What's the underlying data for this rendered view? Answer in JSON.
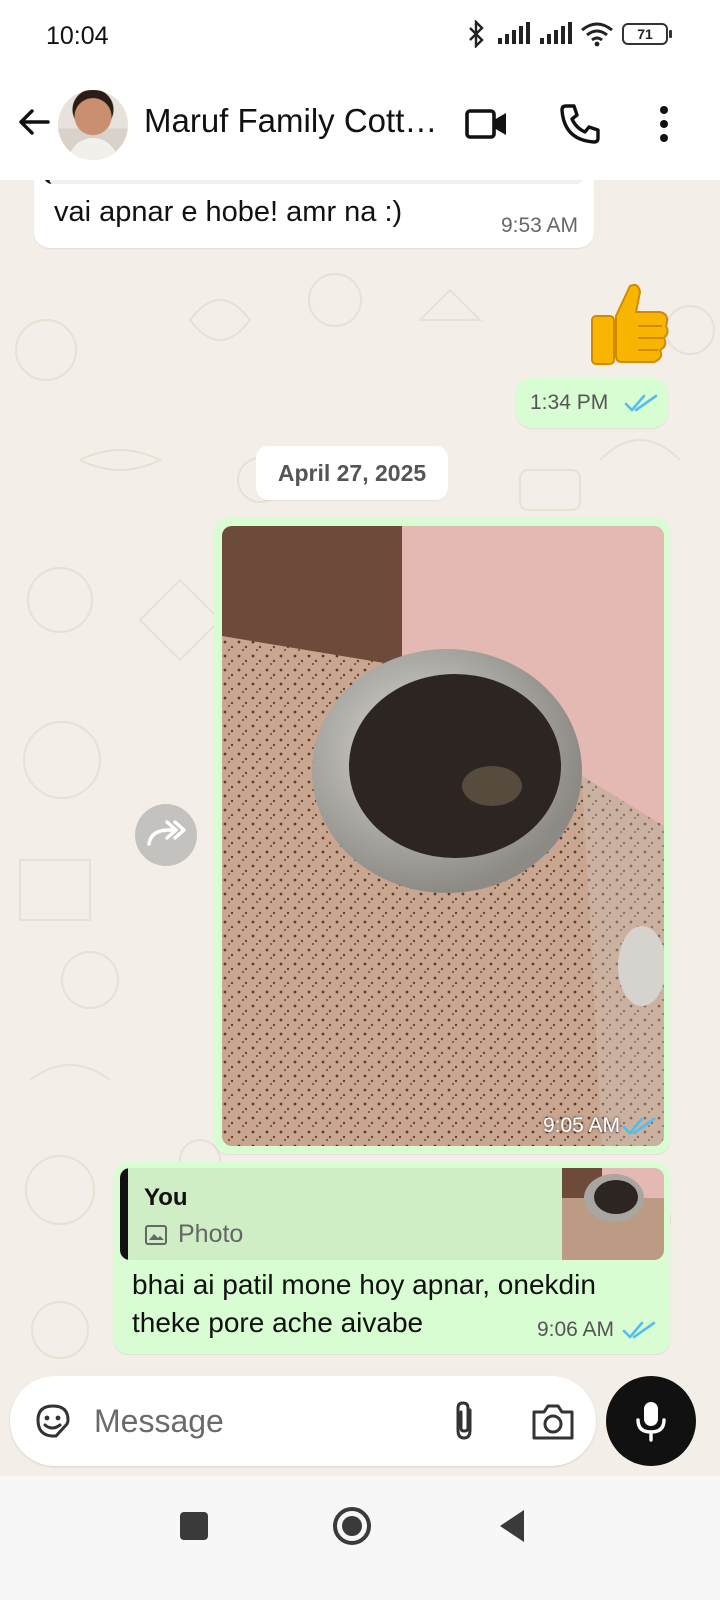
{
  "status_bar": {
    "time": "10:04",
    "battery": "71"
  },
  "header": {
    "title": "Maruf Family Cott…",
    "icons": [
      "back-arrow-icon",
      "video-call-icon",
      "voice-call-icon",
      "more-options-icon"
    ]
  },
  "messages": {
    "incoming_text": {
      "text": "vai apnar e hobe! amr na :)",
      "time": "9:53 AM"
    },
    "outgoing_emoji": {
      "emoji": "thumbs-up-icon",
      "time": "1:34 PM"
    },
    "date_chip": "April 27, 2025",
    "outgoing_photo": {
      "time": "9:05 AM"
    },
    "outgoing_reply": {
      "quote_author": "You",
      "quote_type": "Photo",
      "text": "bhai ai patil mone hoy apnar, onekdin theke pore ache aivabe",
      "time": "9:06 AM"
    }
  },
  "composer": {
    "placeholder": "Message"
  },
  "colors": {
    "outgoing_bubble": "#d9fdd3",
    "incoming_bubble": "#ffffff",
    "read_ticks": "#53bdeb",
    "wallpaper": "#f3efe8",
    "mic_button": "#111111"
  }
}
